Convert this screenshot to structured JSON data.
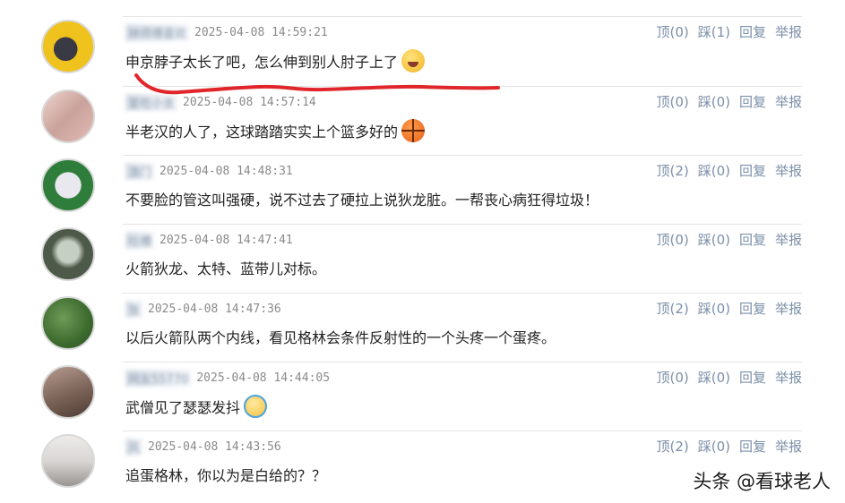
{
  "comments": [
    {
      "username": "林师傅喜欢",
      "time": "2025-04-08 14:59:21",
      "text": "申京脖子太长了吧，怎么伸到别人肘子上了",
      "emoji": "grin-emoji",
      "actions": {
        "up": "顶(0)",
        "down": "踩(1)",
        "reply": "回复",
        "report": "举报"
      },
      "avatar_colors": [
        "#f0c21d",
        "#3a3a44"
      ]
    },
    {
      "username": "爱吃小支",
      "time": "2025-04-08 14:57:14",
      "text": "半老汉的人了，这球踏踏实实上个篮多好的",
      "emoji": "basketball-emoji",
      "actions": {
        "up": "顶(0)",
        "down": "踩(0)",
        "reply": "回复",
        "report": "举报"
      },
      "avatar_colors": [
        "#e3b9b4",
        "#c9a39b"
      ]
    },
    {
      "username": "澳门",
      "time": "2025-04-08 14:48:31",
      "text": "不要脸的管这叫强硬，说不过去了硬拉上说狄龙脏。一帮丧心病狂得垃圾！",
      "emoji": "",
      "actions": {
        "up": "顶(2)",
        "down": "踩(0)",
        "reply": "回复",
        "report": "举报"
      },
      "avatar_colors": [
        "#2f7d3a",
        "#e8e8ee"
      ]
    },
    {
      "username": "吐槽",
      "time": "2025-04-08 14:47:41",
      "text": "火箭狄龙、太特、蓝带儿对标。",
      "emoji": "",
      "actions": {
        "up": "顶(0)",
        "down": "踩(0)",
        "reply": "回复",
        "report": "举报"
      },
      "avatar_colors": [
        "#4d5a49",
        "#c6cfc4"
      ]
    },
    {
      "username": "张",
      "time": "2025-04-08 14:47:36",
      "text": "以后火箭队两个内线，看见格林会条件反射性的一个头疼一个蛋疼。",
      "emoji": "",
      "actions": {
        "up": "顶(2)",
        "down": "踩(0)",
        "reply": "回复",
        "report": "举报"
      },
      "avatar_colors": [
        "#3c6b2e",
        "#6f9a58"
      ]
    },
    {
      "username": "网友55770",
      "time": "2025-04-08 14:44:05",
      "text": "武僧见了瑟瑟发抖",
      "emoji": "shiver-emoji",
      "actions": {
        "up": "顶(0)",
        "down": "踩(0)",
        "reply": "回复",
        "report": "举报"
      },
      "avatar_colors": [
        "#7a6257",
        "#b79c8f"
      ]
    },
    {
      "username": "风",
      "time": "2025-04-08 14:43:56",
      "text": "追蛋格林，你以为是白给的？？",
      "emoji": "",
      "actions": {
        "up": "顶(2)",
        "down": "踩(0)",
        "reply": "回复",
        "report": "举报"
      },
      "avatar_colors": [
        "#d9d6d4",
        "#9a9592"
      ]
    }
  ],
  "underline_color": "#e0262b",
  "watermark": "头条 @看球老人"
}
